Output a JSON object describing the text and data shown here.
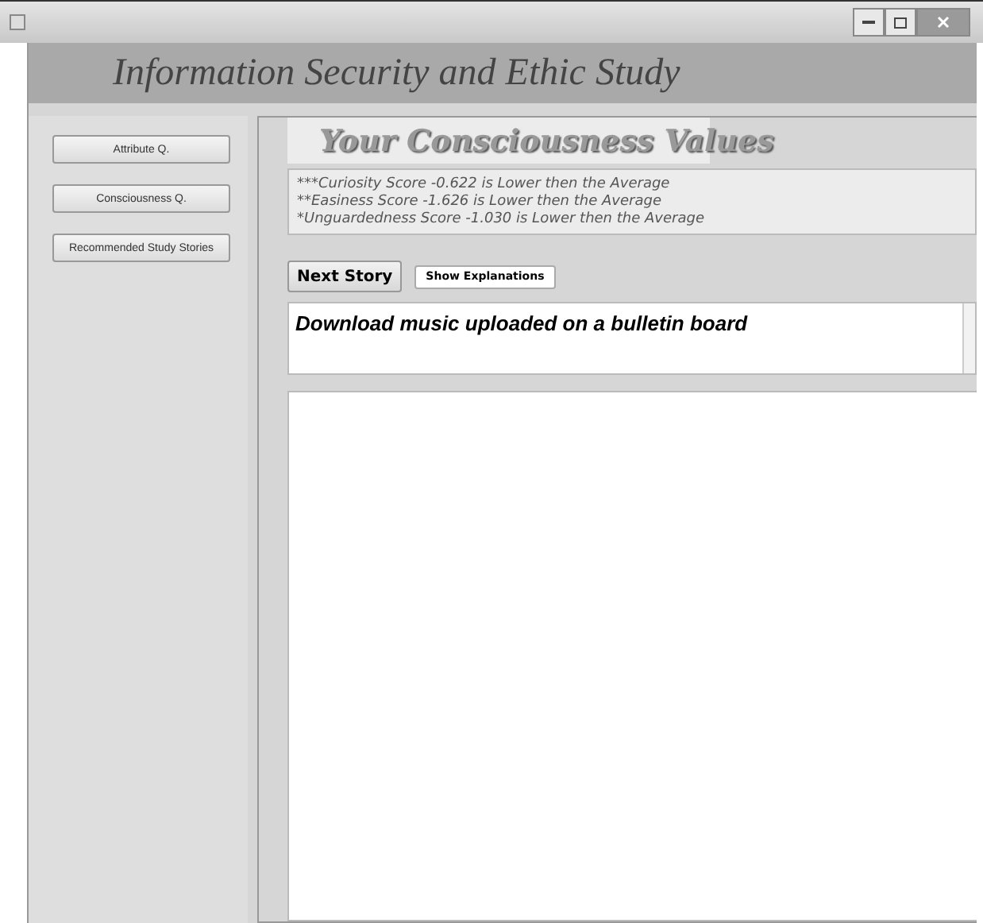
{
  "header": {
    "title": "Information Security and Ethic Study"
  },
  "sidebar": {
    "buttons": [
      "Attribute Q.",
      "Consciousness Q.",
      "Recommended Study Stories"
    ]
  },
  "banner": {
    "title": "Your Consciousness Values"
  },
  "scores": [
    "***Curiosity Score -0.622 is Lower then the Average",
    "**Easiness Score -1.626 is Lower then the Average",
    "*Unguardedness Score -1.030 is Lower then the Average"
  ],
  "actions": {
    "next": "Next Story",
    "explain": "Show Explanations"
  },
  "story": {
    "title": "Download music uploaded on a bulletin board"
  }
}
